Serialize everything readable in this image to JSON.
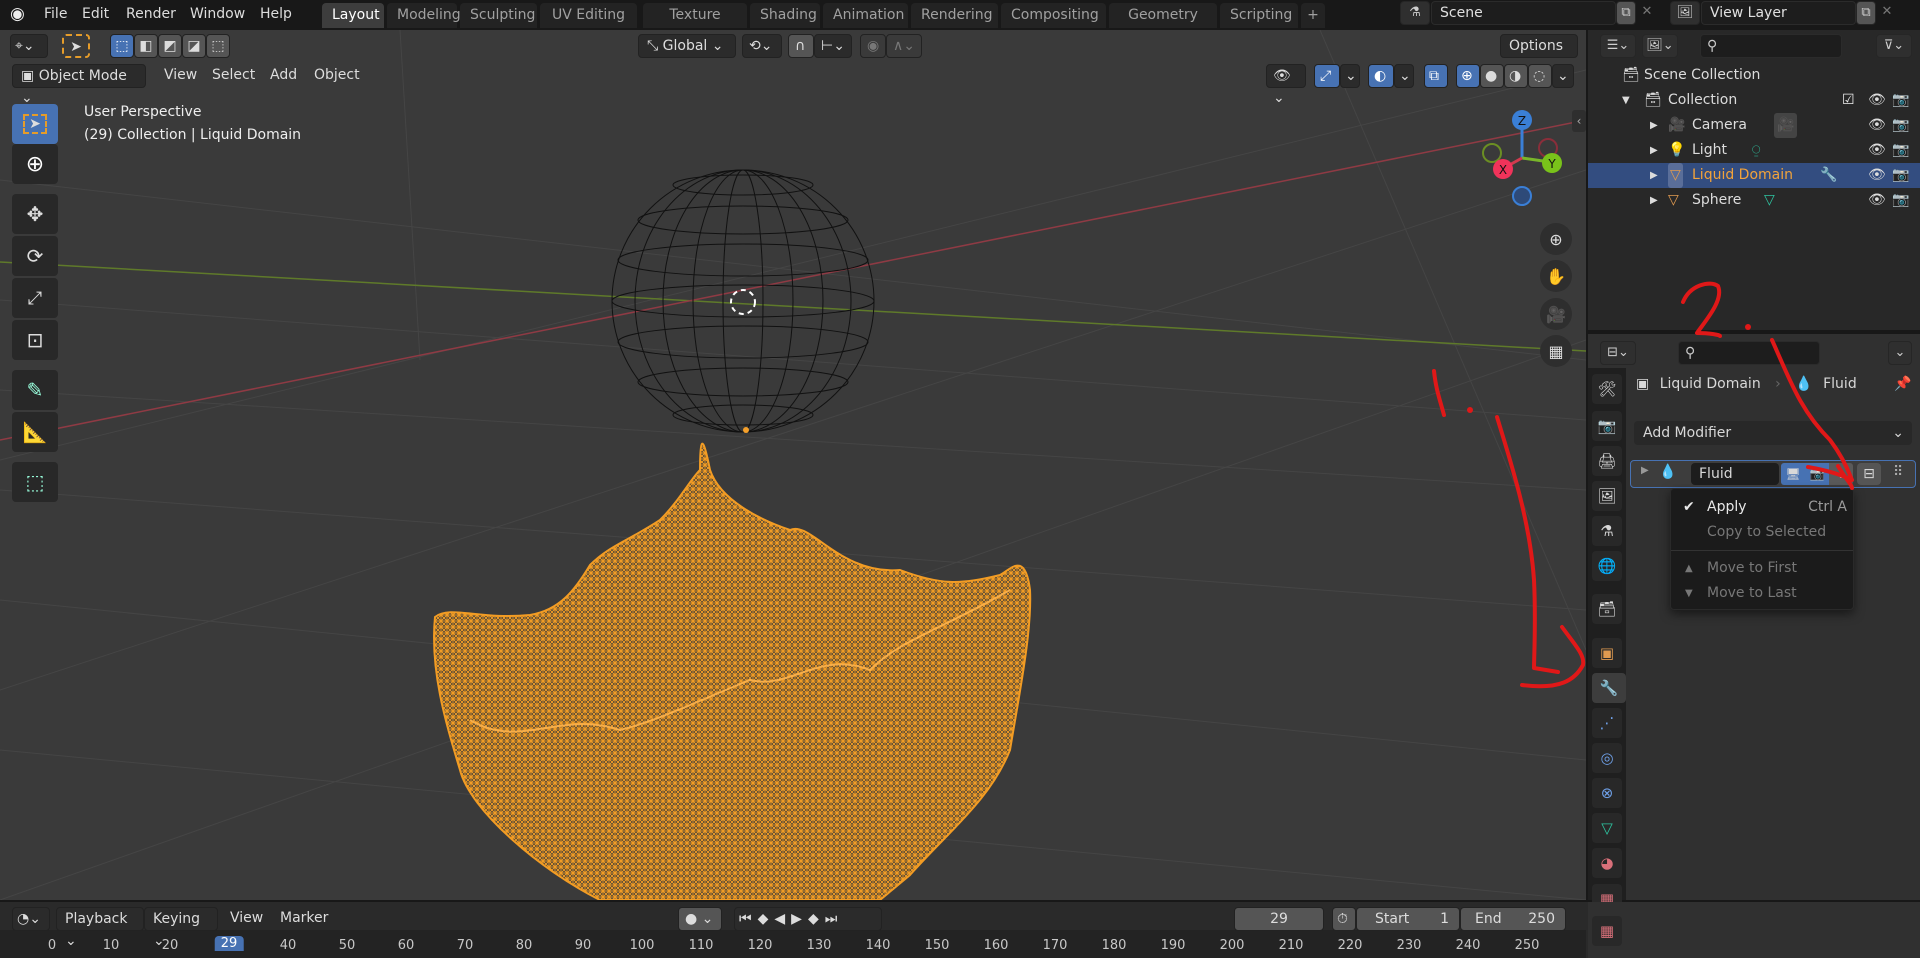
{
  "menubar": {
    "items": [
      "File",
      "Edit",
      "Render",
      "Window",
      "Help"
    ],
    "workspaces": [
      "Layout",
      "Modeling",
      "Sculpting",
      "UV Editing",
      "Texture Paint",
      "Shading",
      "Animation",
      "Rendering",
      "Compositing",
      "Geometry Nodes",
      "Scripting"
    ],
    "active_workspace": "Layout",
    "add_workspace": "+",
    "scene": "Scene",
    "view_layer": "View Layer"
  },
  "viewport": {
    "mode": "Object Mode",
    "menus": [
      "View",
      "Select",
      "Add",
      "Object"
    ],
    "transform_orientation": "Global",
    "options_label": "Options",
    "overlay_title": "User Perspective",
    "overlay_subtitle": "(29) Collection | Liquid Domain",
    "gizmo_axes": {
      "x": "X",
      "y": "Y",
      "z": "Z"
    },
    "colors": {
      "selected_wire": "#f5a02a",
      "x_axis": "#c0404e",
      "y_axis": "#6b8e23",
      "active_blue": "#4772b3"
    }
  },
  "outliner": {
    "root": "Scene Collection",
    "collection": "Collection",
    "objects": [
      {
        "name": "Camera",
        "icon": "camera-icon",
        "data_icon": "camera-data-icon",
        "selected": false
      },
      {
        "name": "Light",
        "icon": "light-icon",
        "data_icon": "light-data-icon",
        "selected": false
      },
      {
        "name": "Liquid Domain",
        "icon": "mesh-object-icon",
        "data_icon": "wrench-icon",
        "selected": true
      },
      {
        "name": "Sphere",
        "icon": "mesh-object-icon",
        "data_icon": "mesh-data-icon",
        "selected": false
      }
    ]
  },
  "properties": {
    "breadcrumb_object": "Liquid Domain",
    "breadcrumb_modifier": "Fluid",
    "add_modifier_label": "Add Modifier",
    "modifier_name": "Fluid",
    "context_menu": {
      "apply_label": "Apply",
      "apply_shortcut": "Ctrl A",
      "copy_label": "Copy to Selected",
      "move_first_label": "Move to First",
      "move_last_label": "Move to Last"
    },
    "tabs": [
      "tool",
      "render",
      "output",
      "view-layer",
      "scene",
      "world",
      "collection",
      "object",
      "modifiers",
      "particles",
      "physics",
      "constraints",
      "data",
      "material",
      "texture"
    ],
    "active_tab": "modifiers"
  },
  "timeline": {
    "menus": [
      "Playback",
      "Keying",
      "View",
      "Marker"
    ],
    "current_frame": "29",
    "start_label": "Start",
    "start_value": "1",
    "end_label": "End",
    "end_value": "250",
    "ruler_ticks": [
      "0",
      "10",
      "20",
      "29",
      "40",
      "50",
      "60",
      "70",
      "80",
      "90",
      "100",
      "110",
      "120",
      "130",
      "140",
      "150",
      "160",
      "170",
      "180",
      "190",
      "200",
      "210",
      "220",
      "230",
      "240",
      "250"
    ]
  },
  "annotations": {
    "step1": "1.",
    "step2": "2."
  }
}
